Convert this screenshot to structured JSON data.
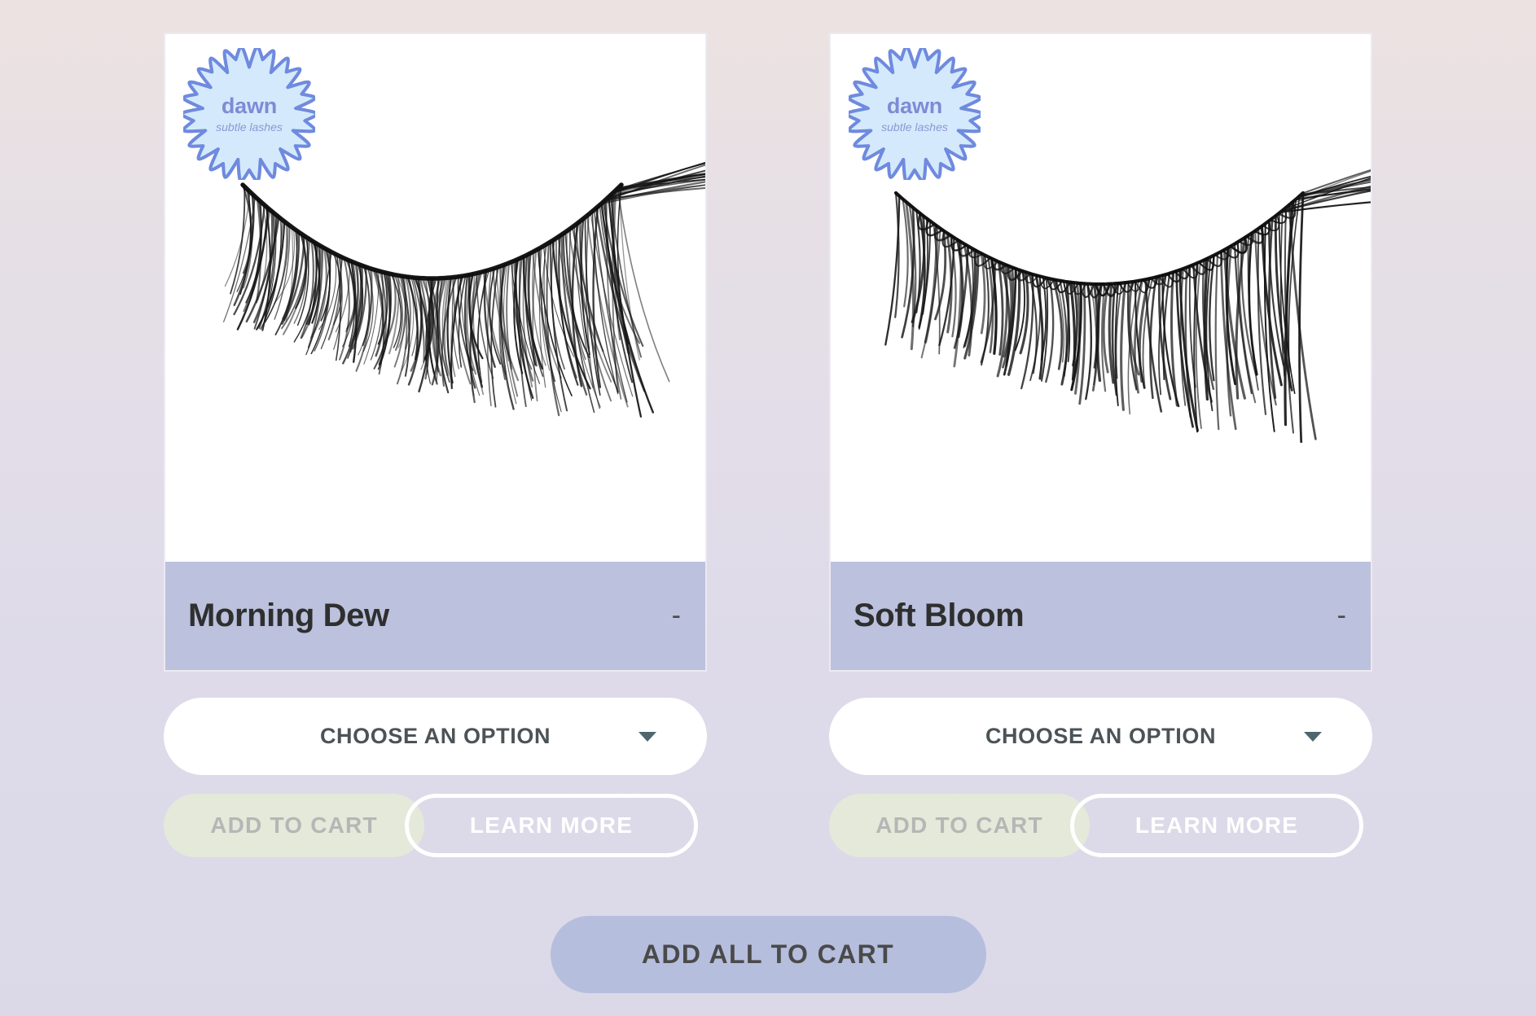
{
  "page": {
    "background_top_color": "#ece2e1",
    "background_bottom_color": "#dcdae8"
  },
  "brand": {
    "name": "dawn",
    "tagline": "subtle lashes",
    "badge_fill": "#d4eafc",
    "badge_border": "#6f8ade",
    "text_color": "#7f8ad6"
  },
  "products": [
    {
      "title": "Morning Dew",
      "price": "-",
      "image_alt": "morning-dew-lash",
      "option_select_label": "CHOOSE AN OPTION",
      "add_to_cart_label": "ADD TO CART",
      "learn_more_label": "LEARN MORE",
      "title_bar_color": "#bcc2dd",
      "add_to_cart_color": "#e4e9da"
    },
    {
      "title": "Soft Bloom",
      "price": "-",
      "image_alt": "soft-bloom-lash",
      "option_select_label": "CHOOSE AN OPTION",
      "add_to_cart_label": "ADD TO CART",
      "learn_more_label": "LEARN MORE",
      "title_bar_color": "#bcc2dd",
      "add_to_cart_color": "#e4e9da"
    }
  ],
  "footer": {
    "add_all_label": "ADD ALL TO CART",
    "add_all_color": "#b6bede"
  }
}
